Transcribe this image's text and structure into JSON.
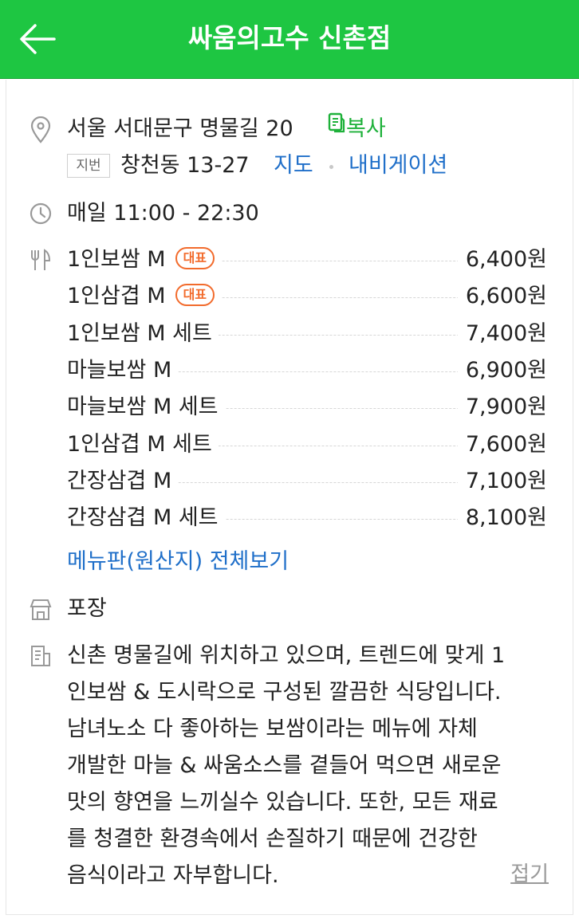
{
  "header": {
    "title": "싸움의고수 신촌점"
  },
  "address": {
    "road": "서울 서대문구 명물길 20",
    "copy_label": "복사",
    "jibun_tag": "지번",
    "jibun": "창천동 13-27",
    "map_label": "지도",
    "navi_label": "내비게이션"
  },
  "hours": {
    "text": "매일 11:00 - 22:30"
  },
  "menu": {
    "badge_label": "대표",
    "items": [
      {
        "name": "1인보쌈 M",
        "price": "6,400원",
        "signature": true
      },
      {
        "name": "1인삼겹 M",
        "price": "6,600원",
        "signature": true
      },
      {
        "name": "1인보쌈 M 세트",
        "price": "7,400원",
        "signature": false
      },
      {
        "name": "마늘보쌈 M",
        "price": "6,900원",
        "signature": false
      },
      {
        "name": "마늘보쌈 M 세트",
        "price": "7,900원",
        "signature": false
      },
      {
        "name": "1인삼겹 M 세트",
        "price": "7,600원",
        "signature": false
      },
      {
        "name": "간장삼겹 M",
        "price": "7,100원",
        "signature": false
      },
      {
        "name": "간장삼겹 M 세트",
        "price": "8,100원",
        "signature": false
      }
    ],
    "view_all_label": "메뉴판(원산지) 전체보기"
  },
  "takeout": {
    "label": "포장"
  },
  "description": {
    "lines": [
      "신촌 명물길에 위치하고 있으며, 트렌드에 맞게 1",
      "인보쌈 & 도시락으로 구성된 깔끔한 식당입니다.",
      " 남녀노소 다 좋아하는 보쌈이라는 메뉴에 자체",
      "개발한 마늘 & 싸움소스를 곁들어 먹으면 새로운",
      " 맛의 향연을 느끼실수 있습니다. 또한, 모든 재료",
      "를 청결한 환경속에서 손질하기 때문에 건강한",
      "음식이라고 자부합니다."
    ],
    "fold_label": "접기"
  },
  "colors": {
    "header_bg": "#1ec642",
    "link": "#1f6fc9",
    "copy_green": "#1eb13a",
    "badge": "#f26b2c"
  },
  "icons": [
    "back-arrow-icon",
    "location-pin-icon",
    "copy-icon",
    "clock-icon",
    "fork-knife-icon",
    "store-icon",
    "document-icon"
  ]
}
